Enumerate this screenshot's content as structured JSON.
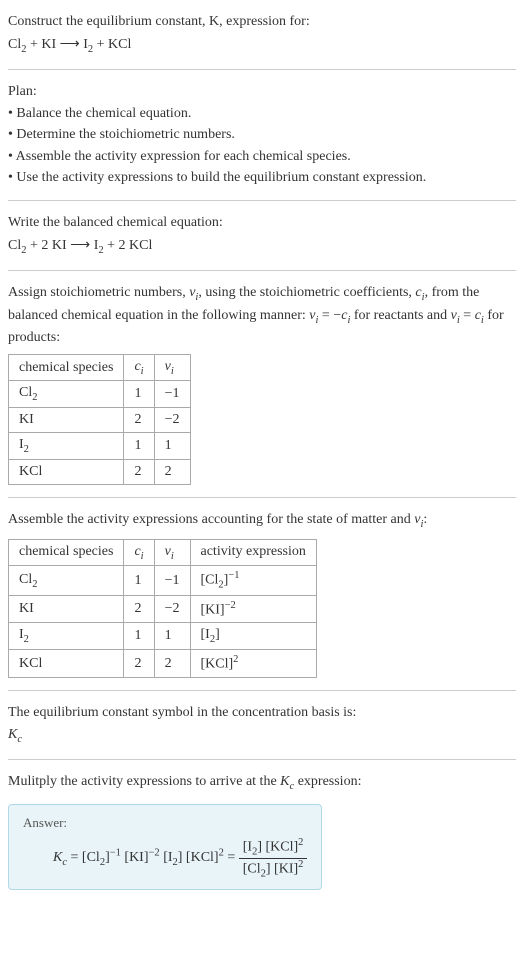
{
  "prompt": {
    "line1": "Construct the equilibrium constant, K, expression for:",
    "equation_left1": "Cl",
    "equation_sub1": "2",
    "equation_plus1": " + KI ",
    "equation_arrow": "⟶",
    "equation_right1": " I",
    "equation_sub2": "2",
    "equation_plus2": " + KCl"
  },
  "plan": {
    "heading": "Plan:",
    "b1": "• Balance the chemical equation.",
    "b2": "• Determine the stoichiometric numbers.",
    "b3": "• Assemble the activity expression for each chemical species.",
    "b4": "• Use the activity expressions to build the equilibrium constant expression."
  },
  "balanced": {
    "heading": "Write the balanced chemical equation:",
    "eq_cl": "Cl",
    "eq_cl_sub": "2",
    "eq_mid1": " + 2 KI ",
    "eq_arrow": "⟶",
    "eq_mid2": " I",
    "eq_i_sub": "2",
    "eq_end": " + 2 KCl"
  },
  "assign": {
    "text_a": "Assign stoichiometric numbers, ",
    "nu_i": "ν",
    "nu_sub": "i",
    "text_b": ", using the stoichiometric coefficients, ",
    "c_i": "c",
    "c_sub": "i",
    "text_c": ", from the balanced chemical equation in the following manner: ",
    "expr1a": "ν",
    "expr1b": "i",
    "expr1c": " = −",
    "expr1d": "c",
    "expr1e": "i",
    "text_d": " for reactants and ",
    "expr2a": "ν",
    "expr2b": "i",
    "expr2c": " = ",
    "expr2d": "c",
    "expr2e": "i",
    "text_e": " for products:"
  },
  "table1": {
    "h1": "chemical species",
    "h2_a": "c",
    "h2_b": "i",
    "h3_a": "ν",
    "h3_b": "i",
    "r1c1a": "Cl",
    "r1c1b": "2",
    "r1c2": "1",
    "r1c3": "−1",
    "r2c1": "KI",
    "r2c2": "2",
    "r2c3": "−2",
    "r3c1a": "I",
    "r3c1b": "2",
    "r3c2": "1",
    "r3c3": "1",
    "r4c1": "KCl",
    "r4c2": "2",
    "r4c3": "2"
  },
  "assemble": {
    "text_a": "Assemble the activity expressions accounting for the state of matter and ",
    "nu": "ν",
    "nu_sub": "i",
    "text_b": ":"
  },
  "table2": {
    "h1": "chemical species",
    "h2_a": "c",
    "h2_b": "i",
    "h3_a": "ν",
    "h3_b": "i",
    "h4": "activity expression",
    "r1c1a": "Cl",
    "r1c1b": "2",
    "r1c2": "1",
    "r1c3": "−1",
    "r1c4a": "[Cl",
    "r1c4b": "2",
    "r1c4c": "]",
    "r1c4d": "−1",
    "r2c1": "KI",
    "r2c2": "2",
    "r2c3": "−2",
    "r2c4a": "[KI]",
    "r2c4b": "−2",
    "r3c1a": "I",
    "r3c1b": "2",
    "r3c2": "1",
    "r3c3": "1",
    "r3c4a": "[I",
    "r3c4b": "2",
    "r3c4c": "]",
    "r4c1": "KCl",
    "r4c2": "2",
    "r4c3": "2",
    "r4c4a": "[KCl]",
    "r4c4b": "2"
  },
  "symbol": {
    "line1": "The equilibrium constant symbol in the concentration basis is:",
    "k": "K",
    "k_sub": "c"
  },
  "multiply": {
    "text_a": "Mulitply the activity expressions to arrive at the ",
    "k": "K",
    "k_sub": "c",
    "text_b": " expression:"
  },
  "answer": {
    "label": "Answer:",
    "lhs_k": "K",
    "lhs_sub": "c",
    "eq1": " = [Cl",
    "cl_sub": "2",
    "eq2": "]",
    "exp_m1": "−1",
    "eq3": " [KI]",
    "exp_m2": "−2",
    "eq4": " [I",
    "i_sub": "2",
    "eq5": "] [KCl]",
    "exp_2": "2",
    "eq6": " = ",
    "num_a": "[I",
    "num_b": "2",
    "num_c": "] [KCl]",
    "num_d": "2",
    "den_a": "[Cl",
    "den_b": "2",
    "den_c": "] [KI]",
    "den_d": "2"
  }
}
